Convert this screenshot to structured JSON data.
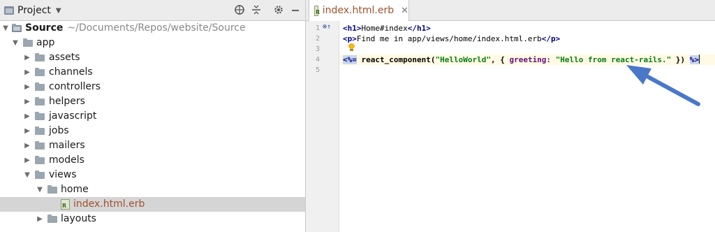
{
  "project_panel": {
    "title": "Project",
    "icons": [
      "target-icon",
      "collapse-icon",
      "gear-icon",
      "hide-icon"
    ],
    "tree": [
      {
        "label": "Source",
        "path": "~/Documents/Repos/website/Source",
        "depth": 0,
        "expanded": true,
        "kind": "module"
      },
      {
        "label": "app",
        "depth": 1,
        "expanded": true,
        "kind": "folder"
      },
      {
        "label": "assets",
        "depth": 2,
        "expanded": false,
        "kind": "folder"
      },
      {
        "label": "channels",
        "depth": 2,
        "expanded": false,
        "kind": "folder"
      },
      {
        "label": "controllers",
        "depth": 2,
        "expanded": false,
        "kind": "folder"
      },
      {
        "label": "helpers",
        "depth": 2,
        "expanded": false,
        "kind": "folder"
      },
      {
        "label": "javascript",
        "depth": 2,
        "expanded": false,
        "kind": "folder"
      },
      {
        "label": "jobs",
        "depth": 2,
        "expanded": false,
        "kind": "folder"
      },
      {
        "label": "mailers",
        "depth": 2,
        "expanded": false,
        "kind": "folder"
      },
      {
        "label": "models",
        "depth": 2,
        "expanded": false,
        "kind": "folder"
      },
      {
        "label": "views",
        "depth": 2,
        "expanded": true,
        "kind": "folder"
      },
      {
        "label": "home",
        "depth": 3,
        "expanded": true,
        "kind": "folder"
      },
      {
        "label": "index.html.erb",
        "depth": 4,
        "kind": "erb",
        "selected": true
      },
      {
        "label": "layouts",
        "depth": 3,
        "expanded": false,
        "kind": "folder"
      }
    ]
  },
  "editor": {
    "tab_label": "index.html.erb",
    "line_numbers": [
      "1",
      "2",
      "3",
      "4",
      "5"
    ],
    "lines": {
      "l1": {
        "open": "<h1>",
        "text": "Home#index",
        "close": "</h1>"
      },
      "l2": {
        "open": "<p>",
        "text": "Find me in app/views/home/index.html.erb",
        "close": "</p>"
      },
      "l4": {
        "erb_open": "<%=",
        "method": "react_component",
        "p1": "(",
        "s1": "\"HelloWorld\"",
        "p2": ", { ",
        "sym": "greeting:",
        "sp": " ",
        "s2": "\"Hello from react-rails.\"",
        "p3": " }) ",
        "erb_close": "%>"
      }
    }
  },
  "colors": {
    "selection": "#d5d5d5",
    "current_line": "#fffae3",
    "annotation_arrow": "#4a78c8"
  }
}
